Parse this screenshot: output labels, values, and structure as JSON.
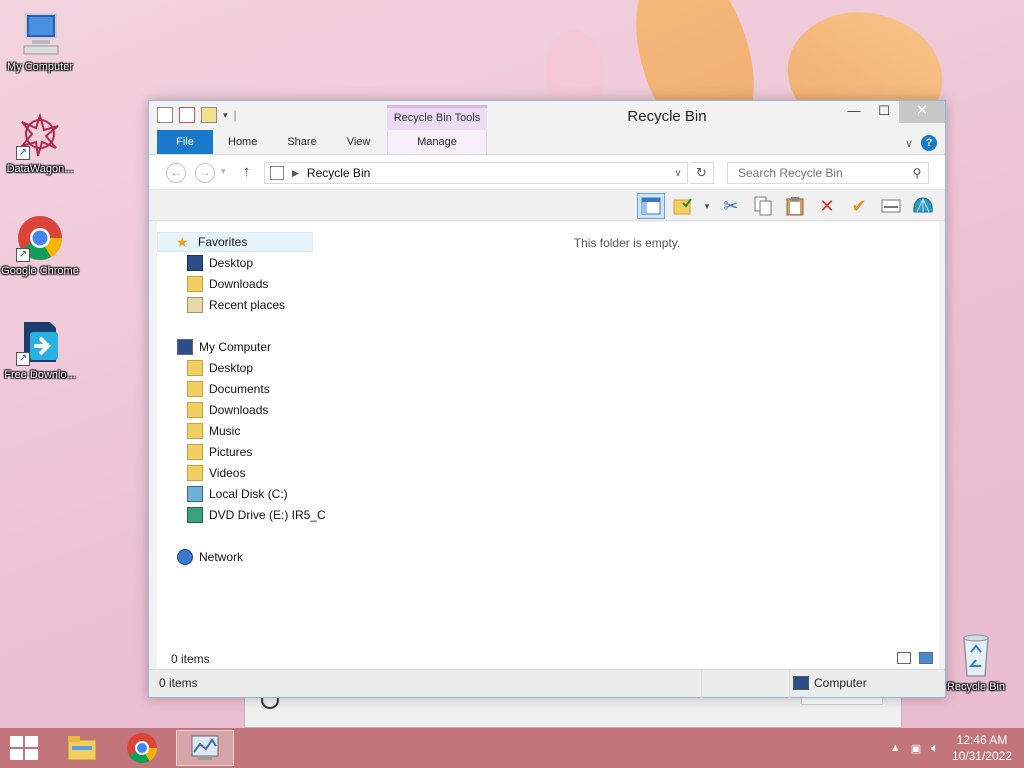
{
  "desktop": {
    "icons": [
      {
        "label": "My Computer",
        "icon": "computer-icon"
      },
      {
        "label": "DataWagon...",
        "icon": "datawagon-icon"
      },
      {
        "label": "Google Chrome",
        "icon": "chrome-icon"
      },
      {
        "label": "Free Downlo...",
        "icon": "download-app-icon"
      },
      {
        "label": "Recycle Bin",
        "icon": "recycle-bin-icon"
      }
    ]
  },
  "window": {
    "title": "Recycle Bin",
    "context_tab": "Recycle Bin Tools",
    "ribbon_tabs": [
      "File",
      "Home",
      "Share",
      "View",
      "Manage"
    ],
    "address": "Recycle Bin",
    "search_placeholder": "Search Recycle Bin",
    "empty_message": "This folder is empty.",
    "nav": {
      "favorites_label": "Favorites",
      "favorites": [
        "Desktop",
        "Downloads",
        "Recent places"
      ],
      "computer_label": "My Computer",
      "computer": [
        "Desktop",
        "Documents",
        "Downloads",
        "Music",
        "Pictures",
        "Videos",
        "Local Disk (C:)",
        "DVD Drive (E:) IR5_C"
      ],
      "network_label": "Network"
    },
    "status_items": "0 items",
    "footer_items": "0 items",
    "footer_location": "Computer"
  },
  "taskbar": {
    "time": "12:46 AM",
    "date": "10/31/2022"
  },
  "colors": {
    "file_tab": "#1979ca",
    "taskbar": "#c2757a",
    "context_tab": "#eedcf4"
  }
}
